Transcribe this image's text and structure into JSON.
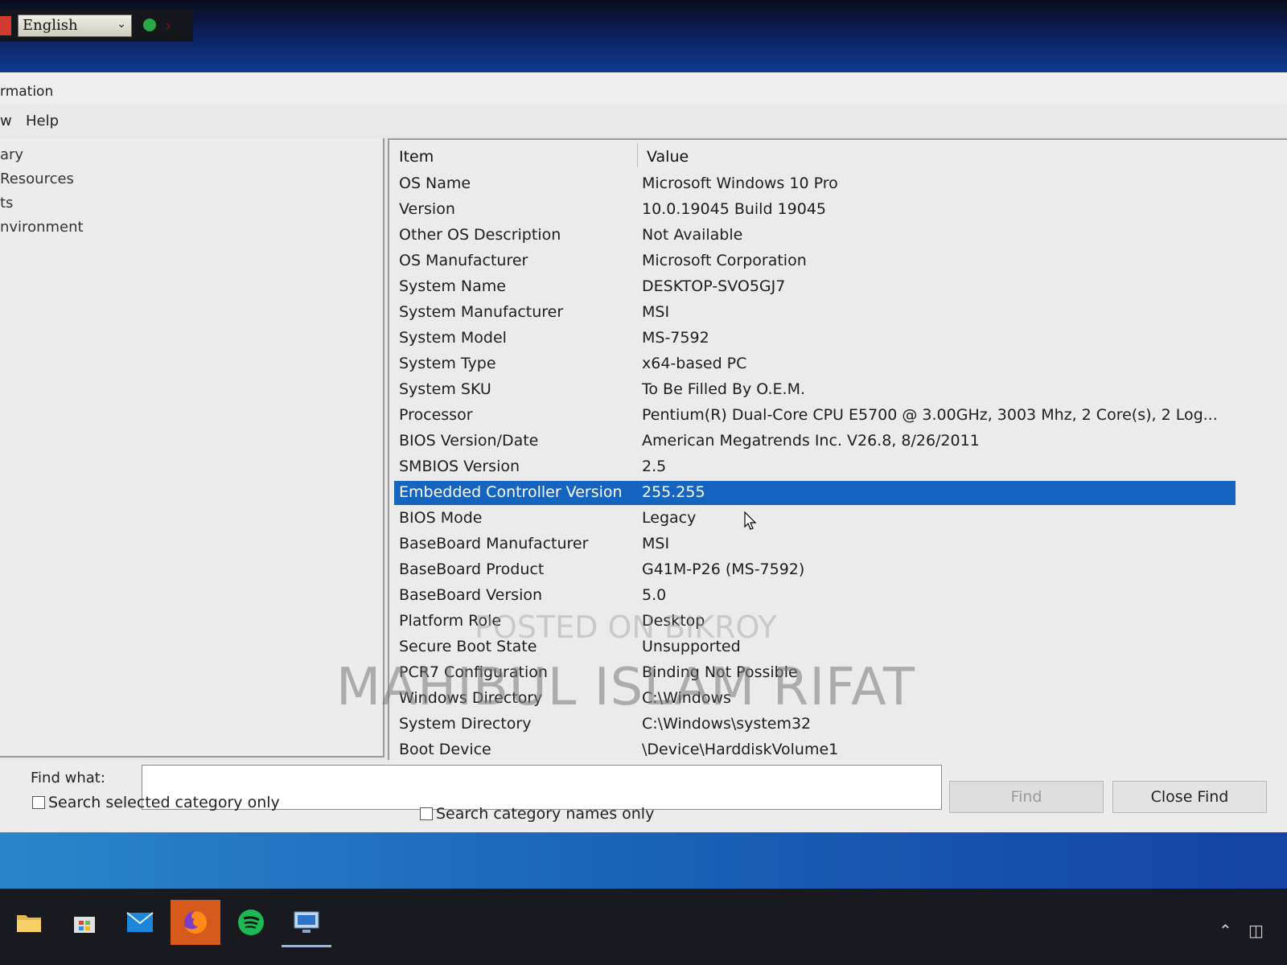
{
  "language_bar": {
    "selected_language": "English"
  },
  "window": {
    "title": "rmation",
    "menu": [
      "w",
      "Help"
    ]
  },
  "tree": {
    "items": [
      "ary",
      "Resources",
      "ts",
      "nvironment"
    ]
  },
  "list": {
    "headers": {
      "item": "Item",
      "value": "Value"
    },
    "rows": [
      {
        "item": "OS Name",
        "value": "Microsoft Windows 10 Pro"
      },
      {
        "item": "Version",
        "value": "10.0.19045 Build 19045"
      },
      {
        "item": "Other OS Description",
        "value": "Not Available"
      },
      {
        "item": "OS Manufacturer",
        "value": "Microsoft Corporation"
      },
      {
        "item": "System Name",
        "value": "DESKTOP-SVO5GJ7"
      },
      {
        "item": "System Manufacturer",
        "value": "MSI"
      },
      {
        "item": "System Model",
        "value": "MS-7592"
      },
      {
        "item": "System Type",
        "value": "x64-based PC"
      },
      {
        "item": "System SKU",
        "value": "To Be Filled By O.E.M."
      },
      {
        "item": "Processor",
        "value": "Pentium(R) Dual-Core  CPU      E5700  @ 3.00GHz, 3003 Mhz, 2 Core(s), 2 Log..."
      },
      {
        "item": "BIOS Version/Date",
        "value": "American Megatrends Inc. V26.8, 8/26/2011"
      },
      {
        "item": "SMBIOS Version",
        "value": "2.5"
      },
      {
        "item": "Embedded Controller Version",
        "value": "255.255"
      },
      {
        "item": "BIOS Mode",
        "value": "Legacy"
      },
      {
        "item": "BaseBoard Manufacturer",
        "value": "MSI"
      },
      {
        "item": "BaseBoard Product",
        "value": "G41M-P26 (MS-7592)"
      },
      {
        "item": "BaseBoard Version",
        "value": "5.0"
      },
      {
        "item": "Platform Role",
        "value": "Desktop"
      },
      {
        "item": "Secure Boot State",
        "value": "Unsupported"
      },
      {
        "item": "PCR7 Configuration",
        "value": "Binding Not Possible"
      },
      {
        "item": "Windows Directory",
        "value": "C:\\Windows"
      },
      {
        "item": "System Directory",
        "value": "C:\\Windows\\system32"
      },
      {
        "item": "Boot Device",
        "value": "\\Device\\HarddiskVolume1"
      }
    ],
    "selected_item": "Embedded Controller Version"
  },
  "find": {
    "label": "Find what:",
    "value": "",
    "find_button": "Find",
    "close_button": "Close Find",
    "search_selected_label": "Search selected category only",
    "search_names_label": "Search category names only"
  },
  "watermark": {
    "line1": "POSTED ON BIKROY",
    "line2": "MAHIBUL ISLAM RIFAT"
  },
  "colors": {
    "selection": "#1565c0",
    "taskbar": "#191a1f",
    "firefox_active": "#d65a1c",
    "spotify": "#1db954"
  },
  "taskbar_icons": [
    "file-explorer-icon",
    "store-icon",
    "mail-icon",
    "firefox-icon",
    "spotify-icon",
    "system-information-icon"
  ]
}
